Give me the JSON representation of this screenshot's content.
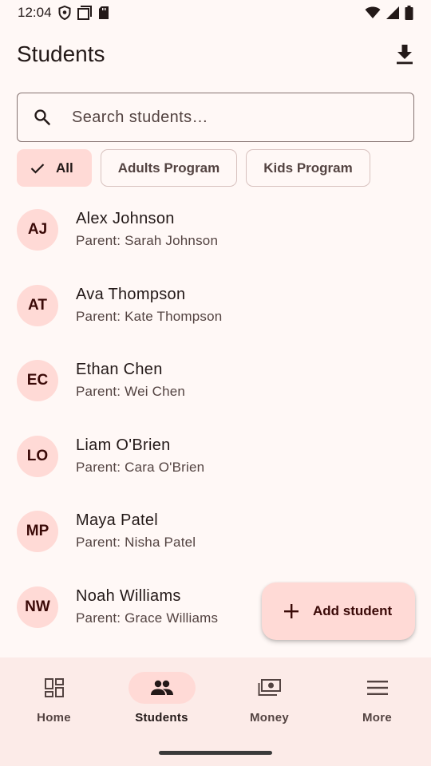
{
  "status": {
    "time": "12:04"
  },
  "header": {
    "title": "Students"
  },
  "search": {
    "placeholder": "Search students…"
  },
  "chips": [
    {
      "label": "All",
      "selected": true
    },
    {
      "label": "Adults Program",
      "selected": false
    },
    {
      "label": "Kids Program",
      "selected": false
    }
  ],
  "students": [
    {
      "initials": "AJ",
      "name": "Alex Johnson",
      "parent": "Parent: Sarah Johnson"
    },
    {
      "initials": "AT",
      "name": "Ava Thompson",
      "parent": "Parent: Kate Thompson"
    },
    {
      "initials": "EC",
      "name": "Ethan Chen",
      "parent": "Parent: Wei Chen"
    },
    {
      "initials": "LO",
      "name": "Liam O'Brien",
      "parent": "Parent: Cara O'Brien"
    },
    {
      "initials": "MP",
      "name": "Maya Patel",
      "parent": "Parent: Nisha Patel"
    },
    {
      "initials": "NW",
      "name": "Noah Williams",
      "parent": "Parent: Grace Williams"
    }
  ],
  "fab": {
    "label": "Add student"
  },
  "nav": [
    {
      "label": "Home",
      "icon": "dashboard-icon",
      "active": false
    },
    {
      "label": "Students",
      "icon": "people-icon",
      "active": true
    },
    {
      "label": "Money",
      "icon": "payments-icon",
      "active": false
    },
    {
      "label": "More",
      "icon": "menu-icon",
      "active": false
    }
  ],
  "colors": {
    "background": "#fff8f6",
    "primary_container": "#ffdad6",
    "on_surface": "#231918",
    "on_surface_variant": "#534341",
    "nav_background": "#fcebe8"
  }
}
